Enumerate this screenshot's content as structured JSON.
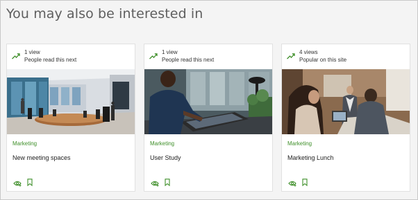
{
  "section": {
    "heading": "You may also be interested in"
  },
  "colors": {
    "accent_green": "#3f8f2a",
    "card_border": "#e1e1e1",
    "background": "#f4f4f4"
  },
  "cards": [
    {
      "views": "1 view",
      "reason": "People read this next",
      "category": "Marketing",
      "title": "New meeting spaces",
      "image": "conference-room-image",
      "icons": [
        "trending-icon",
        "follow-icon",
        "bookmark-icon"
      ]
    },
    {
      "views": "1 view",
      "reason": "People read this next",
      "category": "Marketing",
      "title": "User Study",
      "image": "user-study-image",
      "icons": [
        "trending-icon",
        "follow-icon",
        "bookmark-icon"
      ]
    },
    {
      "views": "4 views",
      "reason": "Popular on this site",
      "category": "Marketing",
      "title": "Marketing Lunch",
      "image": "meeting-image",
      "icons": [
        "trending-icon",
        "follow-icon",
        "bookmark-icon"
      ]
    }
  ]
}
